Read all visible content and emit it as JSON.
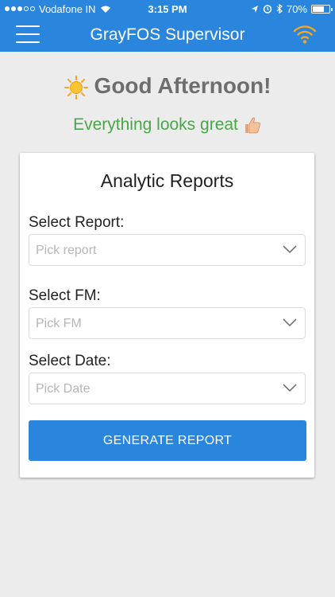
{
  "status_bar": {
    "carrier": "Vodafone IN",
    "time": "3:15 PM",
    "battery": "70%",
    "battery_level": 0.7,
    "icons": [
      "signal-icon",
      "wifi-icon",
      "location-icon",
      "alarm-icon",
      "bluetooth-icon",
      "battery-icon"
    ]
  },
  "navbar": {
    "title": "GrayFOS Supervisor",
    "menu_icon": "hamburger-menu-icon",
    "right_icon": "wifi-icon",
    "accent_color": "#2a85dd"
  },
  "greeting": {
    "text": "Good Afternoon!",
    "icon": "sun-icon",
    "status": "Everything looks great",
    "status_icon": "thumbs-up-icon",
    "status_color": "#4aa64a"
  },
  "card": {
    "title": "Analytic Reports",
    "fields": [
      {
        "label": "Select Report:",
        "placeholder": "Pick report"
      },
      {
        "label": "Select FM:",
        "placeholder": "Pick FM"
      },
      {
        "label": "Select Date:",
        "placeholder": "Pick Date"
      }
    ],
    "button_label": "GENERATE REPORT"
  }
}
